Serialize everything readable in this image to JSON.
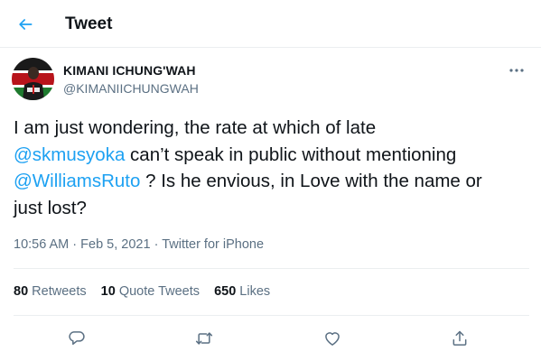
{
  "colors": {
    "accent": "#1da1f2",
    "muted": "#5b7083",
    "text": "#0f1419",
    "divider": "#ebeef0"
  },
  "header": {
    "title": "Tweet",
    "back_icon": "arrow-left-icon"
  },
  "author": {
    "name": "KIMANI ICHUNG'WAH",
    "handle": "@KIMANIICHUNGWAH",
    "more_icon": "more-horizontal-icon"
  },
  "tweet": {
    "segments": [
      "I am just wondering, the rate at which of late ",
      "@skmusyoka",
      " can’t speak in public without mentioning ",
      "@WilliamsRuto",
      " ? Is he envious, in Love with the name or just lost?"
    ],
    "time": "10:56 AM",
    "date": "Feb 5, 2021",
    "source": "Twitter for iPhone"
  },
  "stats": {
    "retweets": {
      "count": "80",
      "label": "Retweets"
    },
    "quotes": {
      "count": "10",
      "label": "Quote Tweets"
    },
    "likes": {
      "count": "650",
      "label": "Likes"
    }
  },
  "actions": [
    "reply-icon",
    "retweet-icon",
    "like-icon",
    "share-icon"
  ]
}
